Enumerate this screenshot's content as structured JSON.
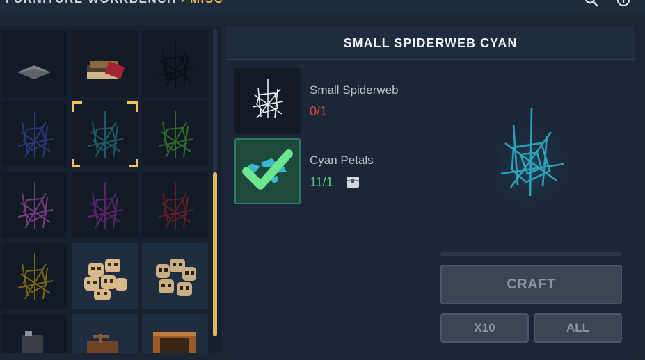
{
  "header": {
    "breadcrumb_parent": "FURNITURE WORKBENCH",
    "breadcrumb_separator": "›",
    "breadcrumb_current": "MISC",
    "icons": [
      "search-icon",
      "info-icon"
    ]
  },
  "grid": {
    "items": [
      {
        "icon": "floor-tile-icon",
        "owned": false
      },
      {
        "icon": "book-stack-icon",
        "owned": false
      },
      {
        "icon": "spiderweb-black-icon",
        "owned": false
      },
      {
        "icon": "spiderweb-blue-icon",
        "owned": false
      },
      {
        "icon": "spiderweb-cyan-icon",
        "owned": false,
        "selected": true
      },
      {
        "icon": "spiderweb-green-icon",
        "owned": false
      },
      {
        "icon": "spiderweb-pink-icon",
        "owned": false
      },
      {
        "icon": "spiderweb-purple-icon",
        "owned": false
      },
      {
        "icon": "spiderweb-red-icon",
        "owned": false
      },
      {
        "icon": "spiderweb-yellow-icon",
        "owned": false
      },
      {
        "icon": "skull-pile-icon",
        "owned": true
      },
      {
        "icon": "skull-pile-dark-icon",
        "owned": true
      },
      {
        "icon": "stone-block-icon",
        "owned": false
      },
      {
        "icon": "wooden-cart-icon",
        "owned": true
      },
      {
        "icon": "wooden-crate-icon",
        "owned": true
      }
    ],
    "scroll_position": 0.55
  },
  "detail": {
    "title": "SMALL SPIDERWEB CYAN",
    "ingredients": [
      {
        "name": "Small Spiderweb",
        "count": "0/1",
        "status": "missing",
        "icon": "spiderweb-white-icon"
      },
      {
        "name": "Cyan Petals",
        "count": "11/1",
        "status": "ok",
        "icon": "cyan-petals-icon"
      }
    ],
    "preview_icon": "spiderweb-cyan-icon"
  },
  "actions": {
    "craft_label": "CRAFT",
    "x10_label": "X10",
    "all_label": "ALL"
  },
  "colors": {
    "accent": "#f0b440",
    "missing": "#e0443c",
    "ok": "#52d27a",
    "cyan": "#2aa3b8"
  }
}
